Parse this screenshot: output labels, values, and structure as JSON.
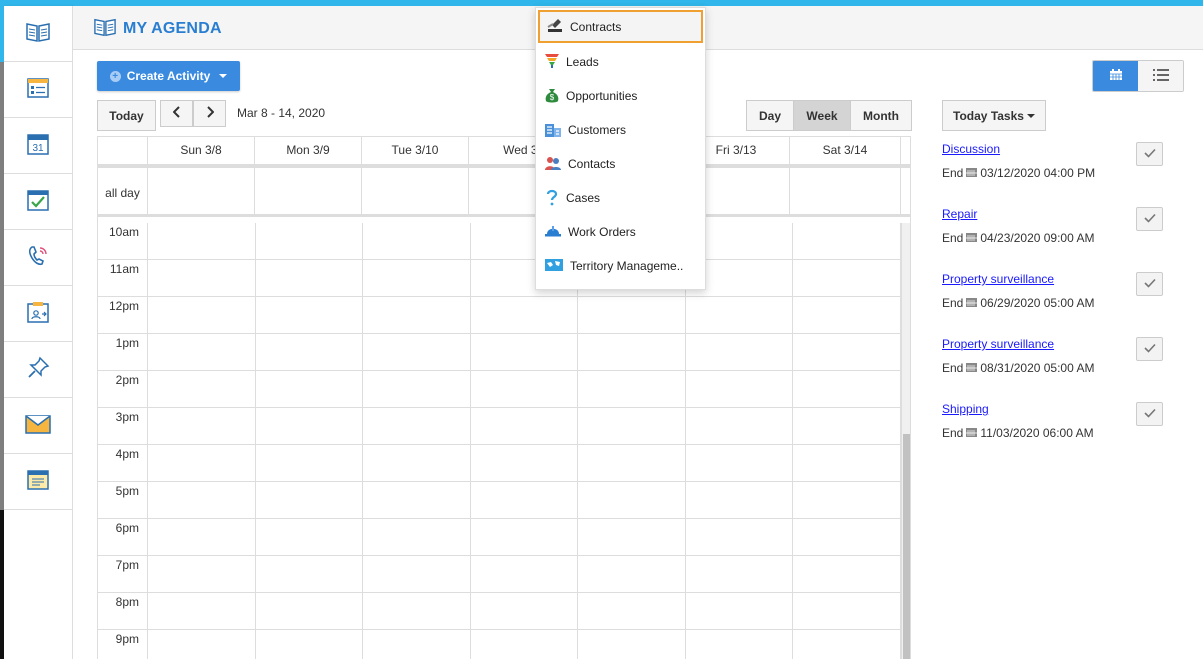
{
  "app": {
    "title": "MY AGENDA",
    "accent_color": "#30b6ea",
    "primary_color": "#3a8be0"
  },
  "sidebar": {
    "items": [
      {
        "icon": "agenda-book-icon"
      },
      {
        "icon": "activities-list-icon"
      },
      {
        "icon": "calendar-31-icon",
        "text": "31"
      },
      {
        "icon": "task-check-icon"
      },
      {
        "icon": "phone-call-icon"
      },
      {
        "icon": "meeting-card-icon"
      },
      {
        "icon": "pin-icon"
      },
      {
        "icon": "email-icon"
      },
      {
        "icon": "notes-icon"
      }
    ]
  },
  "toolbar": {
    "create_label": "Create Activity",
    "today_label": "Today",
    "prev_icon": "chevron-left-icon",
    "next_icon": "chevron-right-icon",
    "date_range": "Mar 8 - 14, 2020",
    "view_day": "Day",
    "view_week": "Week",
    "view_month": "Month",
    "selected_view": "Week"
  },
  "calendar": {
    "days": [
      "Sun 3/8",
      "Mon 3/9",
      "Tue 3/10",
      "Wed 3/",
      "",
      "Fri 3/13",
      "Sat 3/14"
    ],
    "allday_label": "all day",
    "hours": [
      "10am",
      "11am",
      "12pm",
      "1pm",
      "2pm",
      "3pm",
      "4pm",
      "5pm",
      "6pm",
      "7pm",
      "8pm",
      "9pm"
    ]
  },
  "dropdown": {
    "items": [
      {
        "label": "Contracts",
        "icon": "gavel-icon",
        "highlighted": true
      },
      {
        "label": "Leads",
        "icon": "funnel-icon"
      },
      {
        "label": "Opportunities",
        "icon": "money-bag-icon"
      },
      {
        "label": "Customers",
        "icon": "building-icon"
      },
      {
        "label": "Contacts",
        "icon": "people-icon"
      },
      {
        "label": "Cases",
        "icon": "question-icon"
      },
      {
        "label": "Work Orders",
        "icon": "hard-hat-icon"
      },
      {
        "label": "Territory Manageme..",
        "icon": "map-icon"
      }
    ]
  },
  "tasks": {
    "header": "Today Tasks",
    "end_prefix": "End",
    "items": [
      {
        "name": "Discussion",
        "end": "03/12/2020 04:00 PM"
      },
      {
        "name": "Repair",
        "end": "04/23/2020 09:00 AM"
      },
      {
        "name": "Property surveillance",
        "end": "06/29/2020 05:00 AM"
      },
      {
        "name": "Property surveillance",
        "end": "08/31/2020 05:00 AM"
      },
      {
        "name": "Shipping",
        "end": "11/03/2020 06:00 AM"
      }
    ]
  }
}
